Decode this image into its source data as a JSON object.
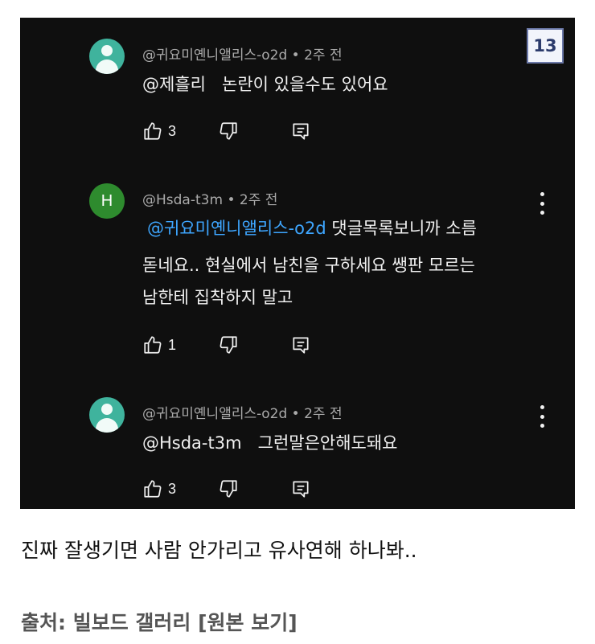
{
  "page_badge": "13",
  "comments": [
    {
      "author": "@귀요미옌니앨리스-o2d",
      "time": "2주 전",
      "avatar": "person",
      "mention": "@제흘리",
      "text": "논란이 있을수도 있어요",
      "likes": "3"
    },
    {
      "author": "@Hsda-t3m",
      "time": "2주 전",
      "avatar_letter": "H",
      "mention": "@귀요미옌니앨리스-o2d",
      "line1": "댓글목록보니까 소름",
      "line2": "돋네요.. 현실에서 남친을 구하세요  쌩판 모르는",
      "line3": "남한테 집착하지 말고",
      "likes": "1"
    },
    {
      "author": "@귀요미옌니앨리스-o2d",
      "time": "2주 전",
      "avatar": "person",
      "mention": "@Hsda-t3m",
      "text": "그런말은안해도돼요",
      "likes": "3"
    }
  ],
  "caption": "진짜 잘생기면 사람 안가리고 유사연해 하나봐..",
  "source": "출처: 빌보드 갤러리 [원본 보기]",
  "meta_separator": "•",
  "colors": {
    "background": "#0f0f0f",
    "mention": "#3ea6ff",
    "avatar_teal": "#3fb39d",
    "avatar_green": "#2e8b2e"
  }
}
